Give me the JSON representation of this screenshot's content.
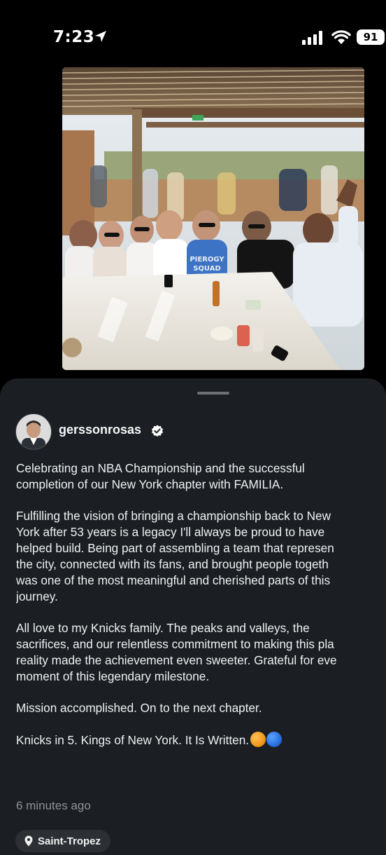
{
  "status_bar": {
    "time": "7:23",
    "battery": "91",
    "icons": [
      "location-arrow-icon",
      "cellular-signal-icon",
      "wifi-icon",
      "battery-icon"
    ]
  },
  "post": {
    "photo_icon": "group-photo-image",
    "username": "gerssonrosas",
    "verified_icon": "verified-badge-icon",
    "caption": [
      "Celebrating an NBA Championship and the successful\ncompletion of our New York chapter with FAMILIA.",
      "Fulfilling the vision of bringing a championship back to New\nYork after 53 years is a legacy I'll always be proud to have\nhelped build. Being part of assembling a team that represen\nthe city, connected with its fans, and brought people togeth\nwas one of the most meaningful and cherished parts of this\njourney.",
      "All love to my Knicks family. The peaks and valleys, the\nsacrifices, and our relentless commitment to making this pla\nreality made the achievement even sweeter. Grateful for eve\nmoment of this legendary milestone.",
      "Mission accomplished. On to the next chapter."
    ],
    "last_line": "Knicks in 5. Kings of New York. It Is Written.",
    "emoji_icons": [
      "orange-circle-emoji",
      "blue-circle-emoji"
    ],
    "timestamp": "6 minutes ago",
    "location": "Saint-Tropez",
    "shirt_text": "PIEROGY\nSQUAD"
  },
  "colors": {
    "background": "#000000",
    "sheet": "#1b1f23",
    "text": "#f0f0f0",
    "muted": "#8e9196"
  }
}
